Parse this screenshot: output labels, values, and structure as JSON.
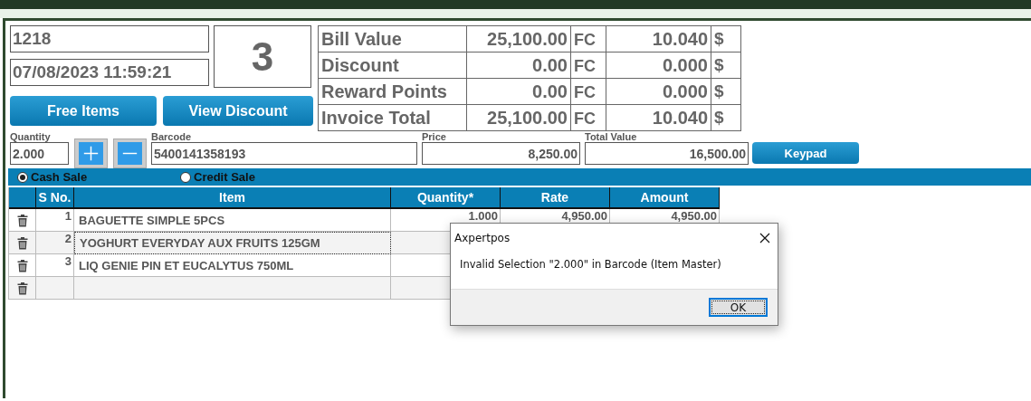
{
  "order_number": "1218",
  "datetime": "07/08/2023 11:59:21",
  "item_count": "3",
  "buttons": [
    "Free Items",
    "View Discount"
  ],
  "summary": [
    {
      "label": "Bill Value",
      "amount": "25,100.00",
      "currency": "FC",
      "usd_amount": "10.040",
      "usd_symbol": "$"
    },
    {
      "label": "Discount",
      "amount": "0.00",
      "currency": "FC",
      "usd_amount": "0.000",
      "usd_symbol": "$"
    },
    {
      "label": "Reward Points",
      "amount": "0.00",
      "currency": "FC",
      "usd_amount": "0.000",
      "usd_symbol": "$"
    },
    {
      "label": "Invoice Total",
      "amount": "25,100.00",
      "currency": "FC",
      "usd_amount": "10.040",
      "usd_symbol": "$"
    }
  ],
  "entry": {
    "quantity_label": "Quantity",
    "quantity": "2.000",
    "barcode_label": "Barcode",
    "barcode": "5400141358193",
    "price_label": "Price",
    "price": "8,250.00",
    "total_label": "Total Value",
    "total": "16,500.00",
    "keypad_button": "Keypad"
  },
  "sale_type": [
    {
      "label": "Cash Sale",
      "selected": true
    },
    {
      "label": "Credit Sale",
      "selected": false
    }
  ],
  "table": {
    "columns": [
      "S No.",
      "Item",
      "Quantity*",
      "Rate",
      "Amount"
    ],
    "rows": [
      {
        "s_no": "1",
        "item": "BAGUETTE SIMPLE 5PCS",
        "quantity": "1.000",
        "rate": "4,950.00",
        "amount": "4,950.00",
        "focused": false
      },
      {
        "s_no": "2",
        "item": "YOGHURT EVERYDAY AUX FRUITS 125GM",
        "focused": true
      },
      {
        "s_no": "3",
        "item": "LIQ GENIE PIN ET EUCALYTUS 750ML",
        "focused": false
      },
      {
        "focused": false
      }
    ]
  },
  "dialog": {
    "title": "Axpertpos",
    "message": "Invalid Selection \"2.000\" in Barcode (Item Master)",
    "button": "OK"
  }
}
